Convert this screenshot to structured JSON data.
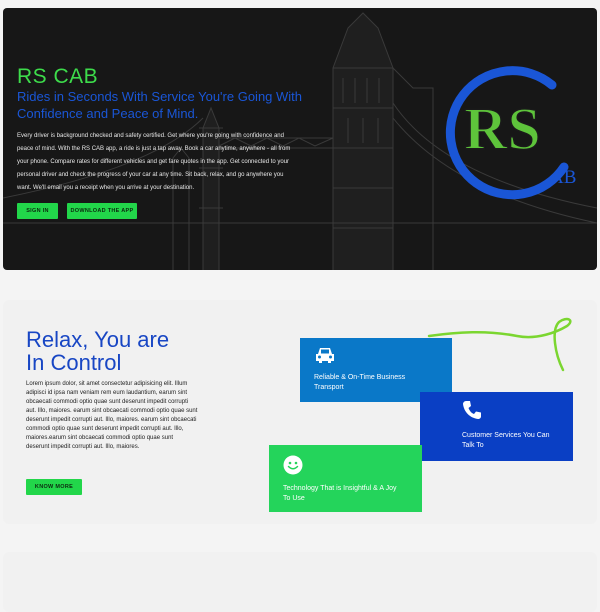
{
  "hero": {
    "title": "RS CAB",
    "subtitle": "Rides in Seconds With Service You're Going With Confidence and Peace of Mind.",
    "description": "Every driver is background checked and safety certified. Get where you're going with confidence and peace of mind. With the RS CAB app, a ride is just a tap away. Book a car anytime, anywhere - all from your phone. Compare rates for different vehicles and get fare quotes in the app. Get connected to your personal driver and check the progress of your car at any time. Sit back, relax, and go anywhere you want. We'll email you a receipt when you arrive at your destination.",
    "signin_label": "SIGN IN",
    "download_label": "DOWNLOAD THE APP",
    "logo_letters": "RS",
    "logo_suffix": "AB"
  },
  "features": {
    "title_line1": "Relax, You are",
    "title_line2": "In Control",
    "body": "Lorem ipsum dolor, sit amet consectetur adipisicing elit. Illum adipisci id ipsa nam veniam rem eum laudantium, earum sint obcaecati commodi optio quae sunt deserunt impedit corrupti aut. Illo, maiores. earum sint obcaecati commodi optio quae sunt deserunt impedit corrupti aut. Illo, maiores. earum sint obcaecati commodi optio quae sunt deserunt impedit corrupti aut. Illo, maiores.earum sint obcaecati commodi optio quae sunt deserunt impedit corrupti aut. Illo, maiores.",
    "know_more_label": "KNOW MORE",
    "cards": [
      {
        "icon": "car-icon",
        "text": "Reliable & On-Time Business Transport"
      },
      {
        "icon": "phone-icon",
        "text": "Customer Services You Can Talk To"
      },
      {
        "icon": "smiley-icon",
        "text": "Technology That is Insightful & A Joy To Use"
      }
    ]
  },
  "colors": {
    "brand_green": "#22d64a",
    "brand_blue": "#1a56d6",
    "card_blue": "#0a78c8",
    "card_navy": "#0a3fc4",
    "card_green": "#24d45b"
  }
}
